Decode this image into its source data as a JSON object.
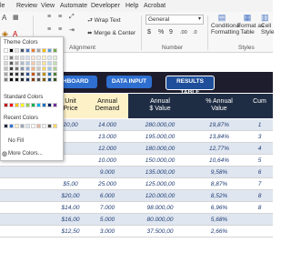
{
  "menubar": [
    "le",
    "Review",
    "View",
    "Automate",
    "Developer",
    "Help",
    "Acrobat"
  ],
  "ribbon": {
    "wrap_text": "Wrap Text",
    "merge_center": "Merge & Center",
    "number_format": "General",
    "currency": "$",
    "percent": "%",
    "comma": "9",
    "dec_up": ".00",
    "dec_down": ".0",
    "conditional_formatting": [
      "Conditional",
      "Formatting"
    ],
    "format_as_table": [
      "Format as",
      "Table"
    ],
    "cell_styles": [
      "Cell",
      "Style"
    ],
    "group_alignment": "Alignment",
    "group_number": "Number",
    "group_styles": "Styles"
  },
  "picker": {
    "theme_colors": "Theme Colors",
    "standard_colors": "Standard Colors",
    "recent_colors": "Recent Colors",
    "no_fill": "No Fill",
    "more_colors": "More Colors...",
    "theme_row": [
      "#ffffff",
      "#000000",
      "#e7e6e6",
      "#44546a",
      "#4472c4",
      "#ed7d31",
      "#a5a5a5",
      "#ffc000",
      "#5b9bd5",
      "#70ad47"
    ],
    "theme_shades": [
      [
        "#f2f2f2",
        "#7f7f7f",
        "#d0cece",
        "#d6dce4",
        "#d9e2f3",
        "#fbe5d5",
        "#ededed",
        "#fff2cc",
        "#deebf6",
        "#e2efd9"
      ],
      [
        "#d8d8d8",
        "#595959",
        "#aeaaaa",
        "#adb9ca",
        "#b4c6e7",
        "#f7cbac",
        "#dbdbdb",
        "#fee599",
        "#bdd7ee",
        "#c5e0b3"
      ],
      [
        "#bfbfbf",
        "#3f3f3f",
        "#757070",
        "#8496b0",
        "#8eaadb",
        "#f4b183",
        "#c9c9c9",
        "#ffd965",
        "#9cc3e5",
        "#a8d08d"
      ],
      [
        "#a5a5a5",
        "#262626",
        "#3a3838",
        "#323f4f",
        "#2f5496",
        "#c55a11",
        "#7b7b7b",
        "#bf8f00",
        "#2e75b5",
        "#538135"
      ],
      [
        "#7f7f7f",
        "#0c0c0c",
        "#171616",
        "#222a35",
        "#1f3864",
        "#833c0b",
        "#525252",
        "#7f6000",
        "#1e4e79",
        "#375623"
      ]
    ],
    "standard_row": [
      "#c00000",
      "#ff0000",
      "#ffc000",
      "#ffff00",
      "#92d050",
      "#00b050",
      "#00b0f0",
      "#0070c0",
      "#002060",
      "#7030a0"
    ],
    "recent_row": [
      "#1f2d44",
      "#2e6fd0",
      "#fdf1c8",
      "#9aa5b8",
      "#dfe6f0",
      "#ffffff",
      "#e6b8a2",
      "#f2f2f2",
      "#4a4a4a",
      "#ffd966"
    ]
  },
  "nav": {
    "dashboard": "SHBOARD",
    "data_input": "DATA INPUT",
    "results_table": "RESULTS TABLE"
  },
  "headers": {
    "price": [
      "Unit",
      "Price"
    ],
    "demand": [
      "Annual",
      "Demand"
    ],
    "value": [
      "Annual",
      "$ Value"
    ],
    "pct": [
      "% Annual",
      "Value"
    ],
    "cum": [
      "Cum",
      ""
    ]
  },
  "rows": [
    {
      "price": "20,00",
      "demand": "14.000",
      "value": "280.000,00",
      "pct": "19,87%",
      "cum": "1"
    },
    {
      "price": "",
      "demand": "13.000",
      "value": "195.000,00",
      "pct": "13,84%",
      "cum": "3"
    },
    {
      "price": "",
      "demand": "12.000",
      "value": "180.000,00",
      "pct": "12,77%",
      "cum": "4"
    },
    {
      "price": "",
      "demand": "10.000",
      "value": "150.000,00",
      "pct": "10,64%",
      "cum": "5"
    },
    {
      "price": "",
      "demand": "9.000",
      "value": "135.000,00",
      "pct": "9,58%",
      "cum": "6"
    },
    {
      "price": "$5,00",
      "demand": "25.000",
      "value": "125.000,00",
      "pct": "8,87%",
      "cum": "7"
    },
    {
      "price": "$20,00",
      "demand": "6.000",
      "value": "120.000,00",
      "pct": "8,52%",
      "cum": "8"
    },
    {
      "price": "$14,00",
      "demand": "7.000",
      "value": "98.000,00",
      "pct": "6,96%",
      "cum": "8"
    },
    {
      "price": "$16,00",
      "demand": "5.000",
      "value": "80.000,00",
      "pct": "5,68%",
      "cum": ""
    },
    {
      "price": "$12,50",
      "demand": "3.000",
      "value": "37.500,00",
      "pct": "2,66%",
      "cum": ""
    }
  ]
}
